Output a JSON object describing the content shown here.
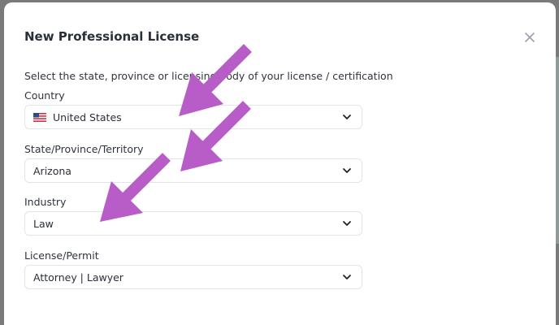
{
  "modal": {
    "title": "New Professional License",
    "intro": "Select the state, province or licensing body of your license / certification"
  },
  "fields": [
    {
      "label": "Country",
      "value": "United States",
      "icon": "us-flag-icon"
    },
    {
      "label": "State/Province/Territory",
      "value": "Arizona"
    },
    {
      "label": "Industry",
      "value": "Law"
    },
    {
      "label": "License/Permit",
      "value": "Attorney | Lawyer"
    }
  ],
  "icons": {
    "close": "close-icon",
    "dropdown": "chevron-down-icon"
  },
  "colors": {
    "annotation_arrow": "#b85cc8",
    "backdrop": "#7a7a7a",
    "title_text": "#2a2f3a"
  }
}
